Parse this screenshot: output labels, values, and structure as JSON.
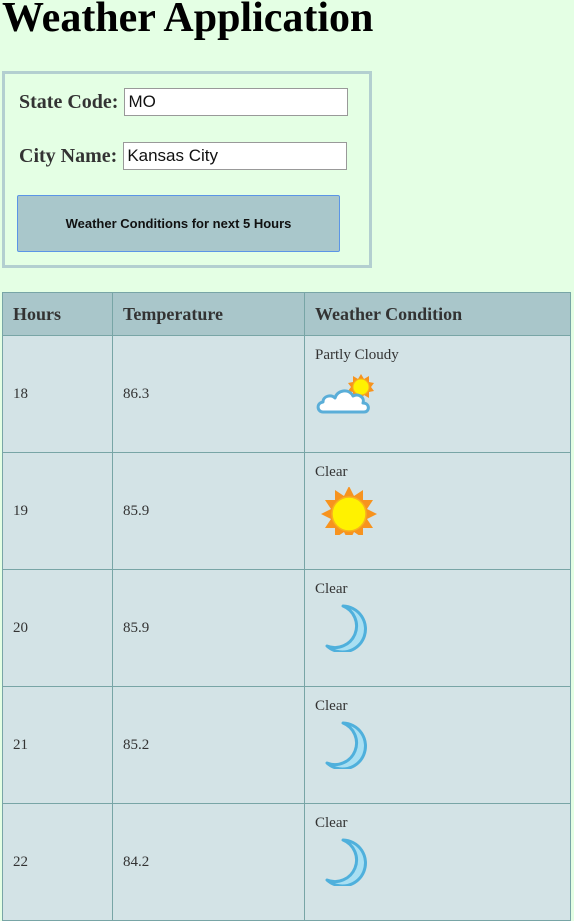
{
  "page": {
    "title": "Weather Application"
  },
  "form": {
    "state_label": "State Code:",
    "state_value": "MO",
    "city_label": "City Name:",
    "city_value": "Kansas City",
    "submit_label": "Weather Conditions for next 5 Hours"
  },
  "table": {
    "headers": [
      "Hours",
      "Temperature",
      "Weather Condition"
    ],
    "rows": [
      {
        "hour": "18",
        "temperature": "86.3",
        "condition": "Partly Cloudy",
        "icon": "partly-cloudy-icon"
      },
      {
        "hour": "19",
        "temperature": "85.9",
        "condition": "Clear",
        "icon": "sun-icon"
      },
      {
        "hour": "20",
        "temperature": "85.9",
        "condition": "Clear",
        "icon": "moon-icon"
      },
      {
        "hour": "21",
        "temperature": "85.2",
        "condition": "Clear",
        "icon": "moon-icon"
      },
      {
        "hour": "22",
        "temperature": "84.2",
        "condition": "Clear",
        "icon": "moon-icon"
      }
    ]
  },
  "colors": {
    "page_background": "#e4ffe4",
    "header_row": "#a9c6ca",
    "cell_background": "#d3e3e6",
    "button": "#a9c7cb"
  }
}
